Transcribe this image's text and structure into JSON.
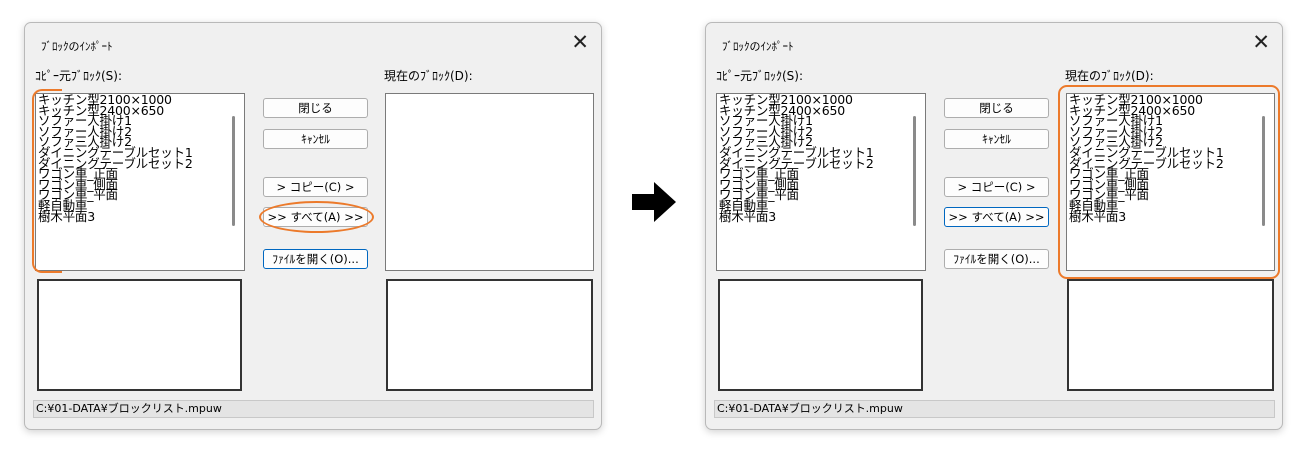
{
  "dialog": {
    "title": "ﾌﾞﾛｯｸのｲﾝﾎﾟｰﾄ",
    "close_glyph": "✕",
    "source_label": "ｺﾋﾟｰ元ﾌﾞﾛｯｸ(S):",
    "current_label": "現在のﾌﾞﾛｯｸ(D):",
    "buttons": {
      "close": "閉じる",
      "cancel": "ｷｬﾝｾﾙ",
      "copy": "> コピー(C) >",
      "all": ">> すべて(A) >>",
      "open": "ﾌｧｲﾙを開く(O)..."
    },
    "status_path": "C:¥01-DATA¥ブロックリスト.mpuw"
  },
  "blocks": [
    "キッチン型2100×1000",
    "キッチン型2400×650",
    "ソファー人掛け1",
    "ソファー人掛け2",
    "ソファ三人掛け2",
    "ダイニングテーブルセット1",
    "ダイニングテーブルセット2",
    "ワゴン車_正面",
    "ワゴン車_側面",
    "ワゴン車_平面",
    "軽自動車",
    "樹木平面3"
  ],
  "transition_icon": "right-arrow-icon",
  "colors": {
    "highlight": "#ec7a2b",
    "focus_border": "#0067c0"
  }
}
